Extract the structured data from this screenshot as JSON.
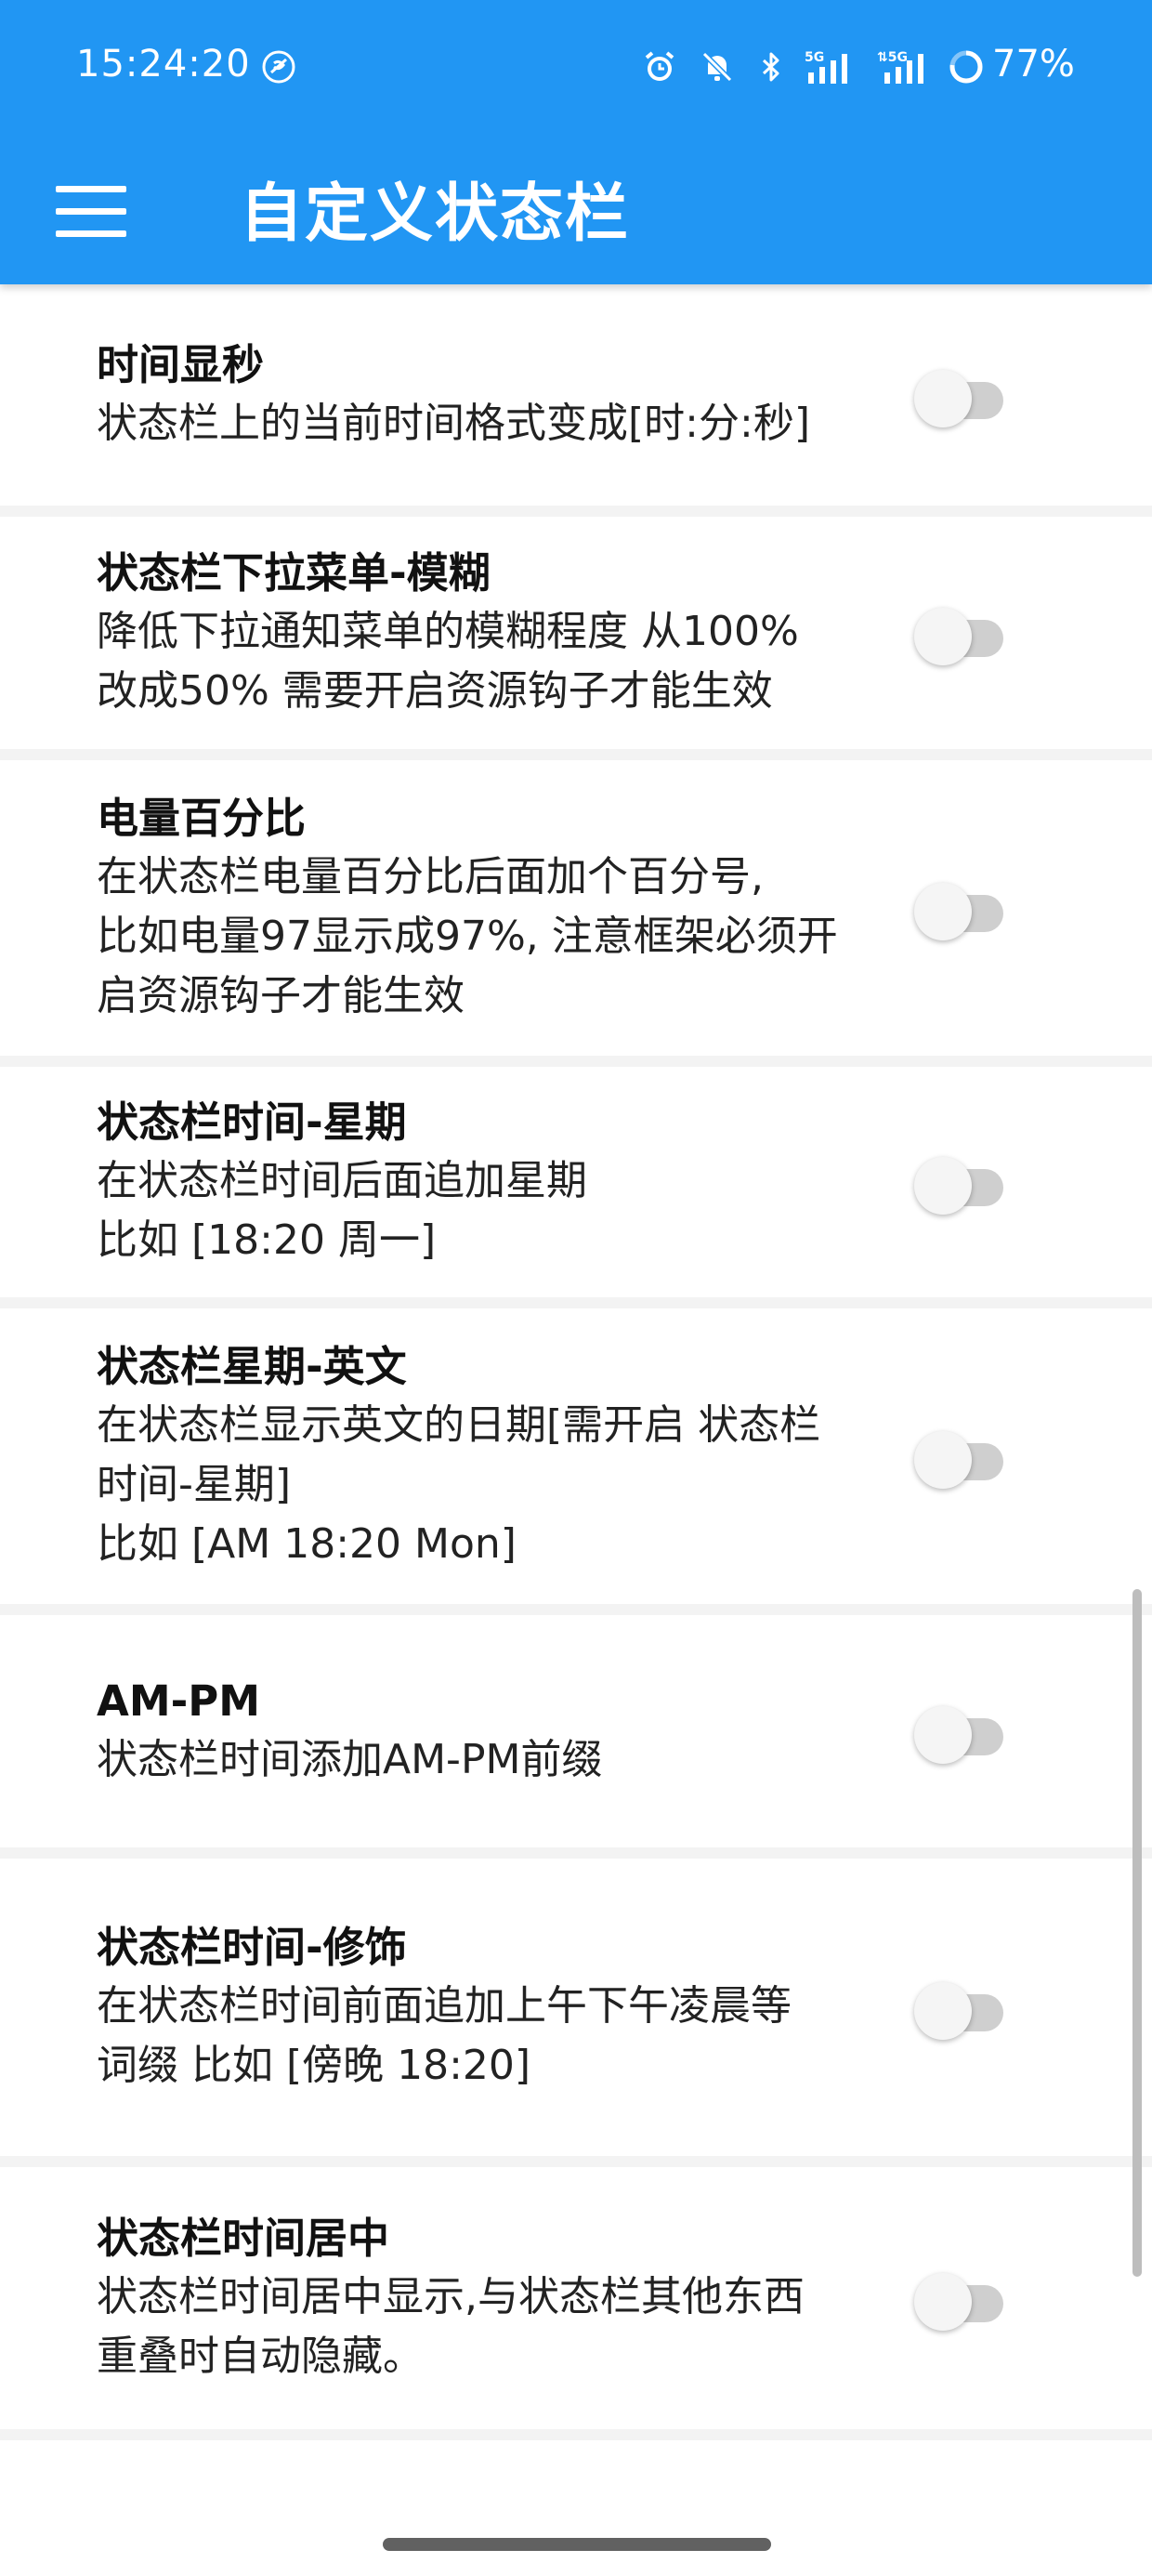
{
  "status_bar": {
    "time": "15:24:20",
    "battery": "77%",
    "icons": [
      "vpn-off-icon",
      "alarm-icon",
      "notifications-off-icon",
      "bluetooth-icon",
      "signal-5g-icon",
      "signal-5g-icon",
      "battery-ring-icon"
    ],
    "battery_level": 0.77
  },
  "toolbar": {
    "title": "自定义状态栏",
    "menu_icon": "hamburger-menu-icon"
  },
  "colors": {
    "primary": "#2196F3",
    "switch_track_off": "#cfcfcf",
    "switch_thumb_off": "#f5f5f5"
  },
  "settings": [
    {
      "title": "时间显秒",
      "desc": "状态栏上的当前时间格式变成[时:分:秒]",
      "enabled": false
    },
    {
      "title": "状态栏下拉菜单-模糊",
      "desc": "降低下拉通知菜单的模糊程度 从100%\n改成50% 需要开启资源钩子才能生效",
      "enabled": false
    },
    {
      "title": "电量百分比",
      "desc": "在状态栏电量百分比后面加个百分号,\n比如电量97显示成97%, 注意框架必须开\n启资源钩子才能生效",
      "enabled": false
    },
    {
      "title": "状态栏时间-星期",
      "desc": "在状态栏时间后面追加星期\n比如 [18:20 周一]",
      "enabled": false
    },
    {
      "title": "状态栏星期-英文",
      "desc": "在状态栏显示英文的日期[需开启 状态栏\n时间-星期]\n比如 [AM 18:20 Mon]",
      "enabled": false
    },
    {
      "title": "AM-PM",
      "desc": "状态栏时间添加AM-PM前缀",
      "enabled": false
    },
    {
      "title": "状态栏时间-修饰",
      "desc": "在状态栏时间前面追加上午下午凌晨等\n词缀 比如 [傍晚 18:20]",
      "enabled": false
    },
    {
      "title": "状态栏时间居中",
      "desc": "状态栏时间居中显示,与状态栏其他东西\n重叠时自动隐藏。",
      "enabled": false
    }
  ]
}
